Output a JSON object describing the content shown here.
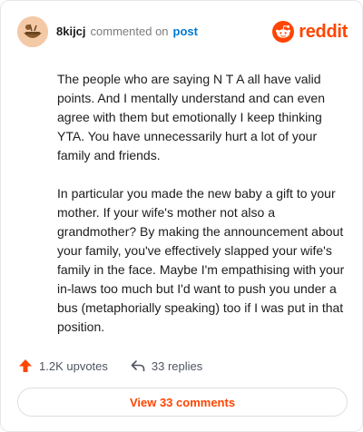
{
  "header": {
    "username": "8kijcj",
    "commented_text": "commented on",
    "post_link": "post",
    "brand": "reddit"
  },
  "comment": {
    "paragraphs": [
      "The people who are saying N T A all have valid points. And I mentally understand and can even agree with them but emotionally I keep thinking YTA. You have unnecessarily hurt a lot of your family and friends.",
      "In particular you made the new baby a gift to your mother. If your wife's mother not also a grandmother? By making the announcement about your family, you've effectively slapped your wife's family in the face. Maybe I'm empathising with your in-laws too much but I'd want to push you under a bus (metaphorially speaking) too if I was put in that position."
    ]
  },
  "footer": {
    "upvotes": "1.2K upvotes",
    "replies": "33 replies",
    "view_button": "View 33 comments"
  },
  "colors": {
    "accent": "#ff4500",
    "link": "#0079d3"
  },
  "icons": {
    "upvote": "upvote-arrow-icon",
    "reply": "reply-arrow-icon",
    "brand": "reddit-logo-icon"
  }
}
